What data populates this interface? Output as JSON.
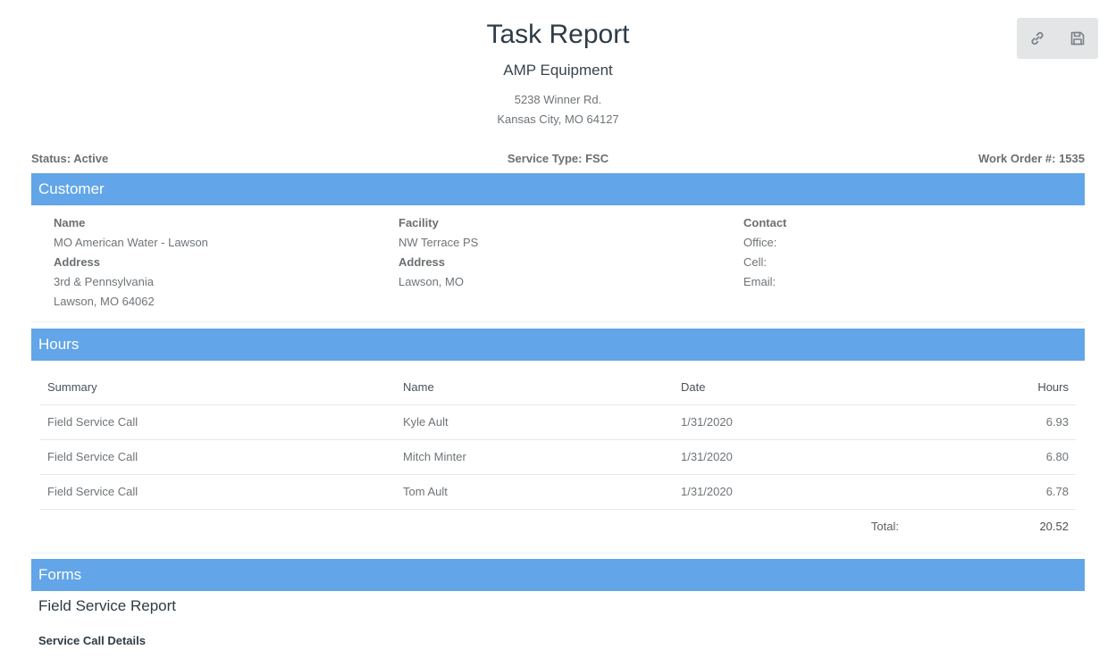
{
  "header": {
    "title": "Task Report",
    "company": "AMP Equipment",
    "address_line1": "5238 Winner Rd.",
    "address_line2": "Kansas City, MO 64127"
  },
  "toolbar": {
    "link_icon": "link-icon",
    "save_icon": "save-icon"
  },
  "meta": {
    "status": "Status: Active",
    "service_type": "Service Type: FSC",
    "work_order": "Work Order #: 1535"
  },
  "customer": {
    "section_title": "Customer",
    "name_label": "Name",
    "name_value": "MO American Water - Lawson",
    "address_label": "Address",
    "address_line1": "3rd & Pennsylvania",
    "address_line2": "Lawson, MO 64062",
    "facility_label": "Facility",
    "facility_value": "NW Terrace PS",
    "facility_address_label": "Address",
    "facility_address_value": "Lawson, MO",
    "contact_label": "Contact",
    "office": "Office:",
    "cell": "Cell:",
    "email": "Email:"
  },
  "hours": {
    "section_title": "Hours",
    "columns": [
      "Summary",
      "Name",
      "Date",
      "Hours"
    ],
    "rows": [
      {
        "summary": "Field Service Call",
        "name": "Kyle Ault",
        "date": "1/31/2020",
        "hours": "6.93"
      },
      {
        "summary": "Field Service Call",
        "name": "Mitch Minter",
        "date": "1/31/2020",
        "hours": "6.80"
      },
      {
        "summary": "Field Service Call",
        "name": "Tom Ault",
        "date": "1/31/2020",
        "hours": "6.78"
      }
    ],
    "total_label": "Total:",
    "total_value": "20.52"
  },
  "forms": {
    "section_title": "Forms",
    "form_title": "Field Service Report",
    "subsection": "Service Call Details"
  },
  "colors": {
    "section_bar": "#62a5e8",
    "title_text": "#2f3b45"
  }
}
